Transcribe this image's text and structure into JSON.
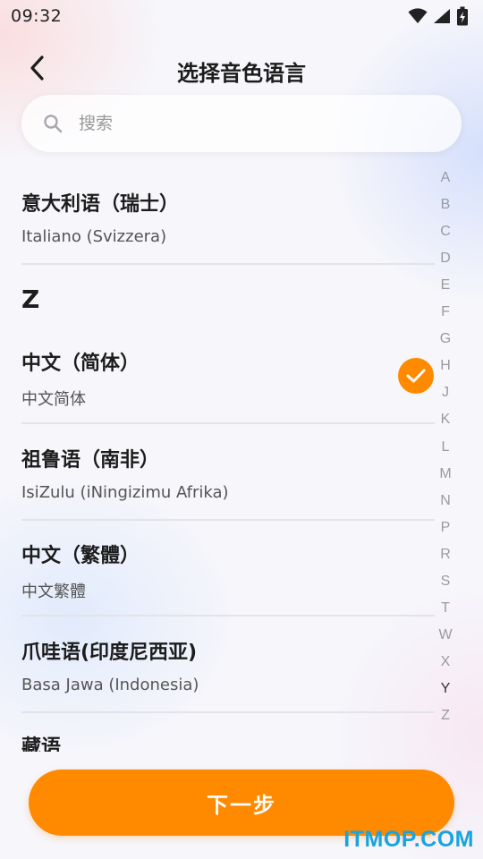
{
  "status_bar": {
    "time": "09:32",
    "icons": [
      "wifi-icon",
      "signal-icon",
      "battery-charging-icon"
    ]
  },
  "header": {
    "title": "选择音色语言",
    "back_icon": "chevron-left-icon"
  },
  "search": {
    "placeholder": "搜索",
    "icon": "search-icon"
  },
  "languages": [
    {
      "name": "意大利语（瑞士）",
      "native": "Italiano (Svizzera)",
      "selected": false
    },
    {
      "section": "Z"
    },
    {
      "name": "中文（简体）",
      "native": "中文简体",
      "selected": true
    },
    {
      "name": "祖鲁语（南非）",
      "native": "IsiZulu (iNingizimu Afrika)",
      "selected": false
    },
    {
      "name": "中文（繁體）",
      "native": "中文繁體",
      "selected": false
    },
    {
      "name": "爪哇语(印度尼西亚)",
      "native": "Basa Jawa (Indonesia)",
      "selected": false
    },
    {
      "name": "藏语",
      "native": "",
      "selected": false
    }
  ],
  "index_bar": {
    "letters": [
      "A",
      "B",
      "C",
      "D",
      "E",
      "F",
      "G",
      "H",
      "J",
      "K",
      "L",
      "M",
      "N",
      "P",
      "R",
      "S",
      "T",
      "W",
      "X",
      "Y",
      "Z"
    ],
    "active": "Y"
  },
  "next_button": {
    "label": "下一步"
  },
  "watermark": "ITMOP.COM",
  "colors": {
    "accent": "#ff8a00",
    "watermark": "#19a4e0"
  }
}
